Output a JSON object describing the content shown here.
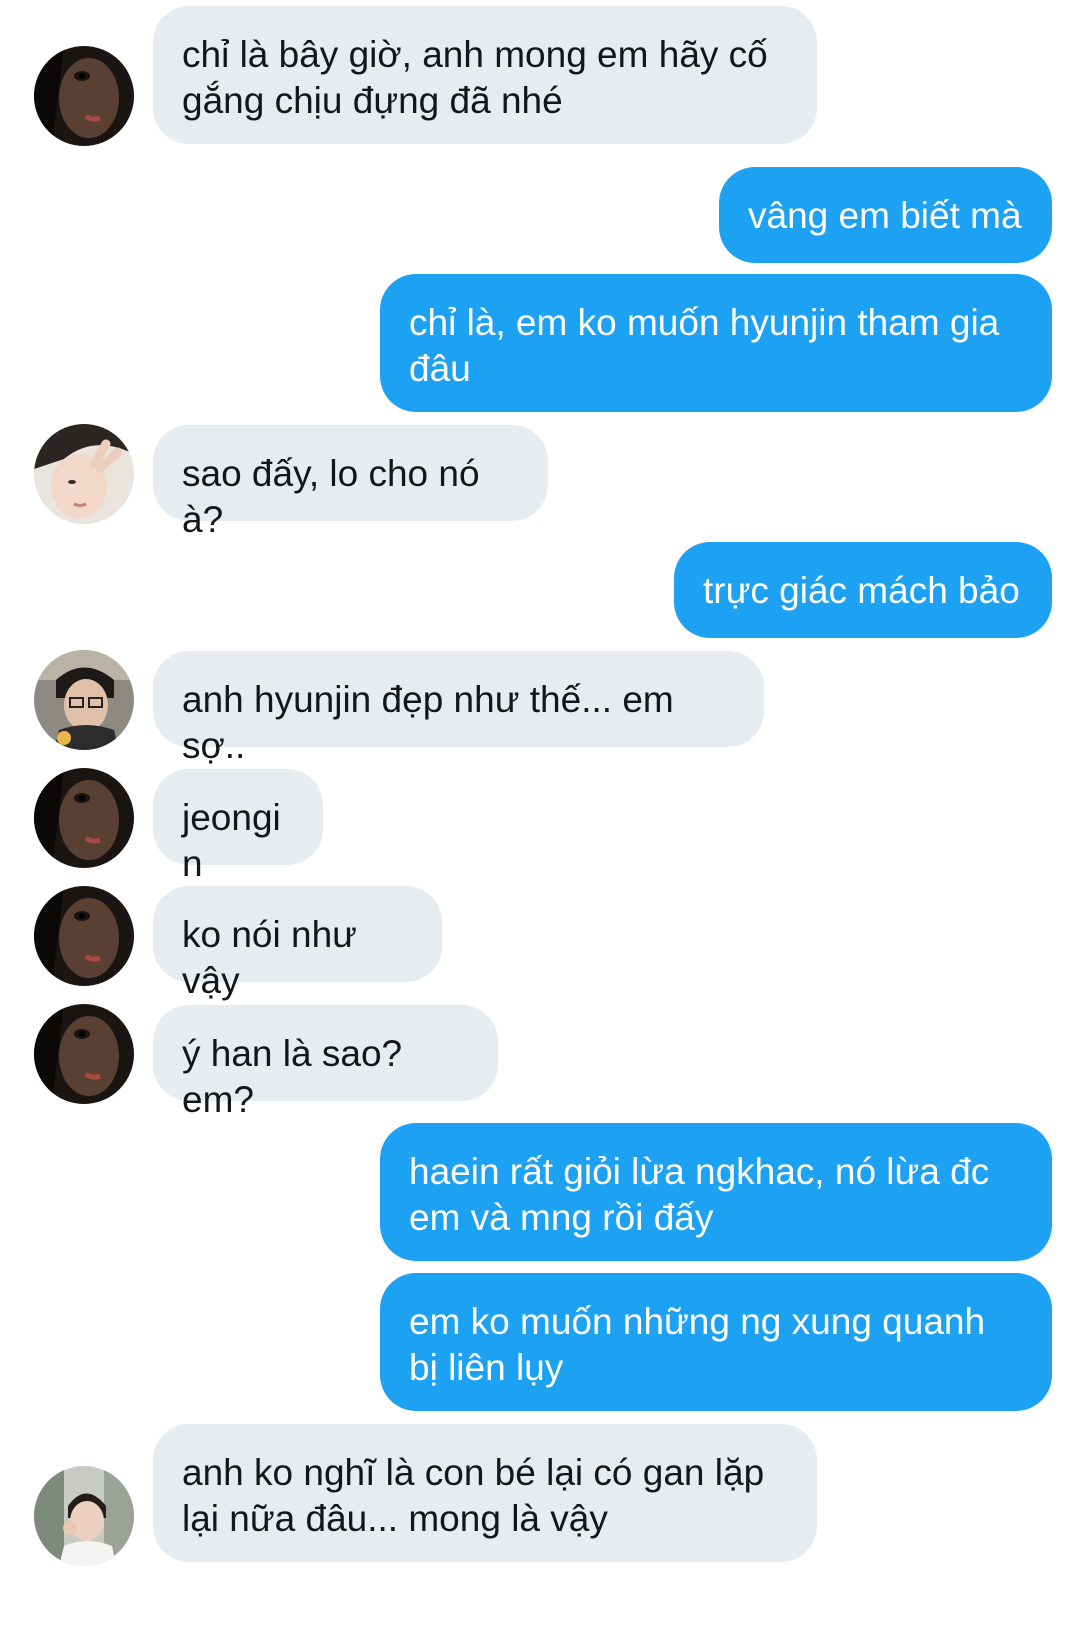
{
  "colors": {
    "incoming_bubble": "#e6ecf0",
    "outgoing_bubble": "#1da1f2",
    "incoming_text": "#14171a",
    "outgoing_text": "#ffffff"
  },
  "messages": [
    {
      "side": "incoming",
      "avatar": "avatar-dark-closeup",
      "text": "chỉ là bây giờ, anh mong em hãy cố gắng chịu đựng đã nhé"
    },
    {
      "side": "outgoing",
      "text": "vâng em biết mà"
    },
    {
      "side": "outgoing",
      "text": "chỉ là, em ko muốn hyunjin tham gia đâu"
    },
    {
      "side": "incoming",
      "avatar": "avatar-peace-sign",
      "text": "sao đấy, lo cho nó à?"
    },
    {
      "side": "outgoing",
      "text": "trực giác mách bảo"
    },
    {
      "side": "incoming",
      "avatar": "avatar-glasses",
      "text": "anh hyunjin đẹp như thế... em sợ.."
    },
    {
      "side": "incoming",
      "avatar": "avatar-dark-closeup",
      "text": "jeongin"
    },
    {
      "side": "incoming",
      "avatar": "avatar-dark-closeup",
      "text": "ko nói như vậy"
    },
    {
      "side": "incoming",
      "avatar": "avatar-dark-closeup",
      "text": "ý han là sao? em?"
    },
    {
      "side": "outgoing",
      "text": "haein rất giỏi lừa ngkhac, nó lừa đc em và mng rồi đấy"
    },
    {
      "side": "outgoing",
      "text": "em ko muốn những ng xung quanh bị liên lụy"
    },
    {
      "side": "incoming",
      "avatar": "avatar-window-portrait",
      "text": "anh ko nghĩ là con bé lại có gan lặp lại nữa đâu... mong là vậy"
    }
  ]
}
